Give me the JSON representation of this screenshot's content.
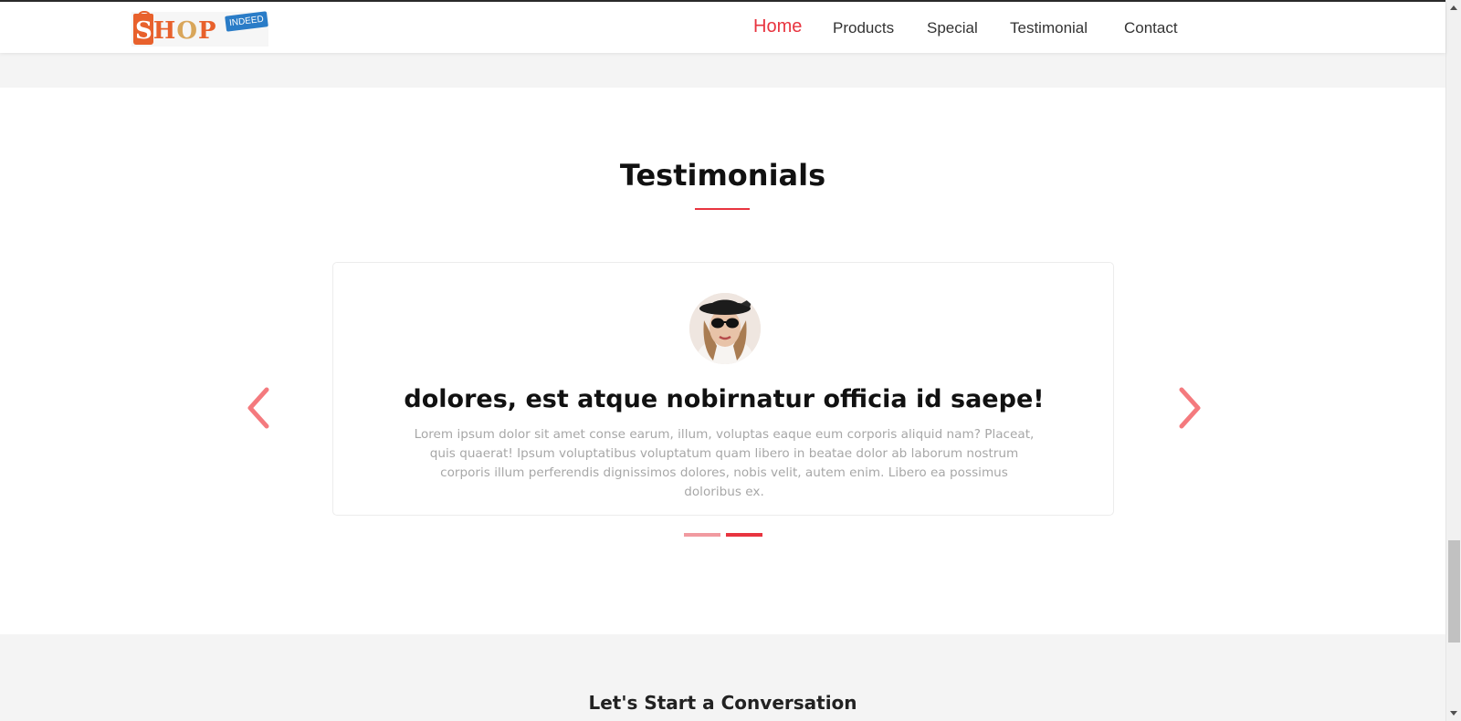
{
  "header": {
    "logo": {
      "text_shop": "SHOP",
      "text_tag": "INDEED"
    },
    "nav": [
      {
        "label": "Home",
        "active": true
      },
      {
        "label": "Products",
        "active": false
      },
      {
        "label": "Special",
        "active": false
      },
      {
        "label": "Testimonial",
        "active": false
      },
      {
        "label": "Contact",
        "active": false
      }
    ]
  },
  "testimonials": {
    "title": "Testimonials",
    "card": {
      "headline": "dolores, est atque nobirnatur officia id saepe!",
      "body": "Lorem ipsum dolor sit amet conse earum, illum, voluptas eaque eum corporis aliquid nam? Placeat, quis quaerat! Ipsum voluptatibus voluptatum quam libero in beatae dolor ab laborum nostrum corporis illum perferendis dignissimos dolores, nobis velit, autem enim. Libero ea possimus doloribus ex."
    },
    "slides_count": 2,
    "active_slide": 2
  },
  "footer": {
    "heading": "Let's Start a Conversation"
  },
  "colors": {
    "accent": "#e8343f",
    "arrow": "#f47a7e",
    "dot_inactive": "#f19aa0",
    "text_muted": "#a7a7a7"
  },
  "icons": {
    "prev": "chevron-left-icon",
    "next": "chevron-right-icon",
    "avatar": "user-avatar"
  }
}
